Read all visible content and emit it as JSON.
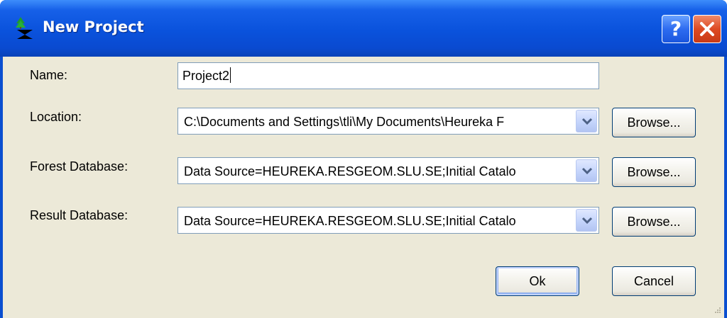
{
  "window": {
    "title": "New Project",
    "help_label": "?",
    "close_icon": "close-icon",
    "app_icon": "tree-app-icon"
  },
  "form": {
    "name": {
      "label": "Name:",
      "value": "Project2"
    },
    "location": {
      "label": "Location:",
      "value": "C:\\Documents and Settings\\tli\\My Documents\\Heureka F",
      "browse_label": "Browse..."
    },
    "forest_database": {
      "label": "Forest Database:",
      "value": "Data Source=HEUREKA.RESGEOM.SLU.SE;Initial Catalo",
      "browse_label": "Browse..."
    },
    "result_database": {
      "label": "Result Database:",
      "value": "Data Source=HEUREKA.RESGEOM.SLU.SE;Initial Catalo",
      "browse_label": "Browse..."
    }
  },
  "footer": {
    "ok_label": "Ok",
    "cancel_label": "Cancel"
  },
  "colors": {
    "titlebar": "#0a52dc",
    "dialog_face": "#ece9d8",
    "close_button": "#de4a22",
    "field_border": "#7f9db9"
  }
}
